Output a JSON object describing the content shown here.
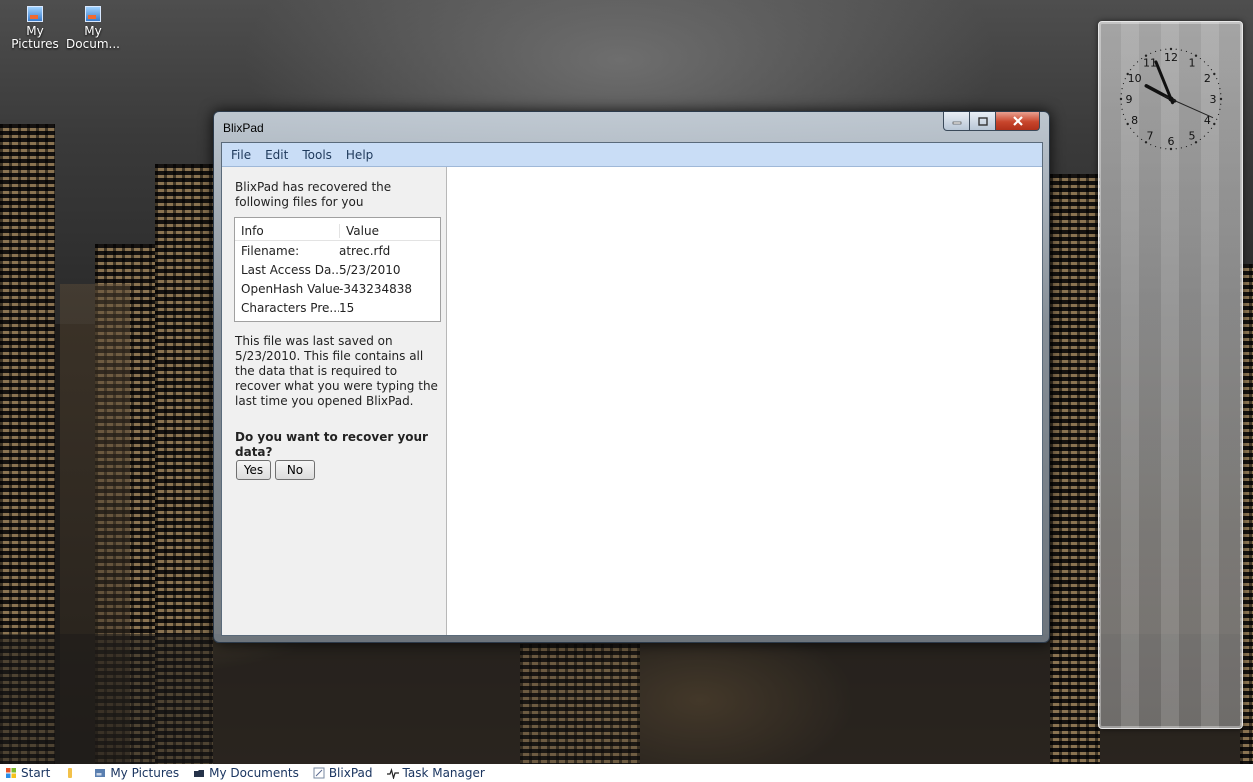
{
  "desktop": {
    "icons": [
      {
        "label_line1": "My",
        "label_line2": "Pictures"
      },
      {
        "label_line1": "My",
        "label_line2": "Docum..."
      }
    ]
  },
  "clock": {
    "numerals": [
      "12",
      "1",
      "2",
      "3",
      "4",
      "5",
      "6",
      "7",
      "8",
      "9",
      "10",
      "11"
    ],
    "hour": 9,
    "minute": 56,
    "second": 19
  },
  "window": {
    "title": "BlixPad",
    "menu": [
      "File",
      "Edit",
      "Tools",
      "Help"
    ],
    "panel": {
      "intro": "BlixPad has recovered the following files for you",
      "table": {
        "headers": [
          "Info",
          "Value"
        ],
        "rows": [
          [
            "Filename:",
            "atrec.rfd"
          ],
          [
            "Last Access Da...",
            "5/23/2010"
          ],
          [
            "OpenHash Value:",
            "-343234838"
          ],
          [
            "Characters Pre...",
            "15"
          ]
        ]
      },
      "saved_text": "This file was last saved on 5/23/2010. This file contains all the data that is required to recover what you were typing the last time you opened BlixPad.",
      "question": "Do you want to recover your data?",
      "yes_label": "Yes",
      "no_label": "No"
    },
    "colors": {
      "menubar": "#c9ddf6",
      "close_button": "#c8452c"
    }
  },
  "taskbar": {
    "items": [
      {
        "label": "Start",
        "icon": "start-orb-icon"
      },
      {
        "label": "",
        "icon": "quick-launch-icon"
      },
      {
        "label": "My Pictures",
        "icon": "pictures-icon"
      },
      {
        "label": "My Documents",
        "icon": "documents-icon"
      },
      {
        "label": "BlixPad",
        "icon": "blixpad-icon"
      },
      {
        "label": "Task Manager",
        "icon": "task-manager-icon"
      }
    ]
  }
}
